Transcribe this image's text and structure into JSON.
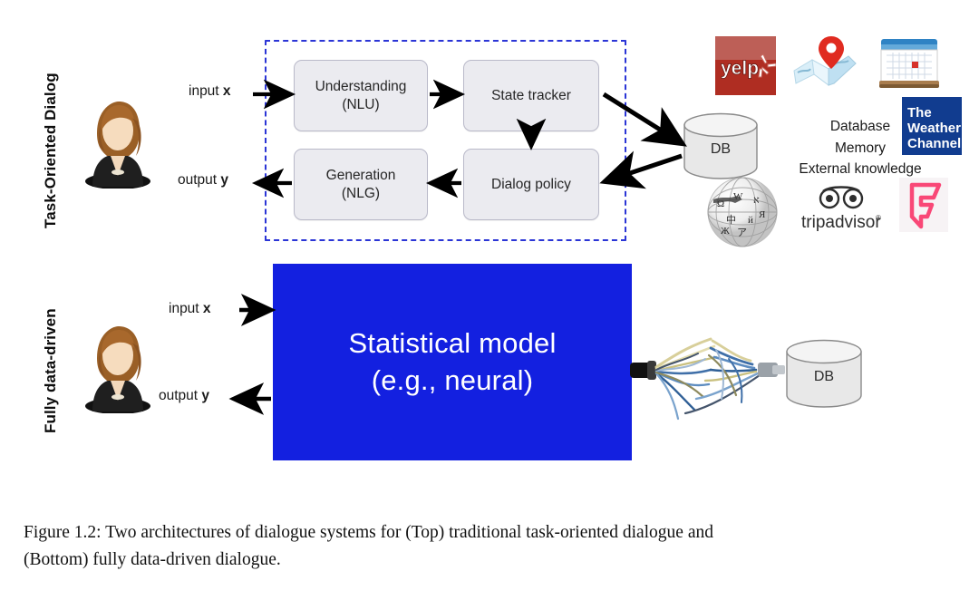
{
  "figure": {
    "caption_line1": "Figure 1.2:  Two architectures of dialogue systems for (Top) traditional task-oriented dialogue and",
    "caption_line2": "(Bottom) fully data-driven dialogue."
  },
  "sections": {
    "top": {
      "label": "Task-Oriented Dialog",
      "input_label_prefix": "input ",
      "input_label_var": "x",
      "output_label_prefix": "output ",
      "output_label_var": "y",
      "modules": [
        {
          "id": "nlu",
          "line1": "Understanding",
          "line2": "(NLU)"
        },
        {
          "id": "state",
          "line1": "State tracker",
          "line2": ""
        },
        {
          "id": "nlg",
          "line1": "Generation",
          "line2": "(NLG)"
        },
        {
          "id": "policy",
          "line1": "Dialog policy",
          "line2": ""
        }
      ],
      "db_label": "DB",
      "sources_line1": "Database",
      "sources_line2": "Memory",
      "sources_line3": "External knowledge",
      "logos": [
        {
          "id": "yelp",
          "name": "yelp-logo",
          "text": "yelp"
        },
        {
          "id": "maps",
          "name": "maps-logo",
          "text": ""
        },
        {
          "id": "calendar",
          "name": "calendar-logo",
          "text": ""
        },
        {
          "id": "weather",
          "name": "weather-channel-logo",
          "line1": "The",
          "line2": "Weather",
          "line3": "Channel"
        },
        {
          "id": "wikipedia",
          "name": "wikipedia-logo",
          "text": ""
        },
        {
          "id": "tripadvisor",
          "name": "tripadvisor-logo",
          "text": "tripadvisor"
        },
        {
          "id": "foursquare",
          "name": "foursquare-logo",
          "text": ""
        }
      ]
    },
    "bottom": {
      "label": "Fully data-driven",
      "input_label_prefix": "input ",
      "input_label_var": "x",
      "output_label_prefix": "output ",
      "output_label_var": "y",
      "model_line1": "Statistical model",
      "model_line2": "(e.g., neural)",
      "db_label": "DB"
    }
  },
  "colors": {
    "dashed_border": "#2b35d6",
    "model_box": "#1320e0",
    "module_fill": "#ebebf0",
    "module_border": "#b9b9c9",
    "arrow": "#000000",
    "weather_blue": "#113c8f",
    "yelp_red": "#af2d22",
    "foursquare_pink": "#f94877"
  }
}
